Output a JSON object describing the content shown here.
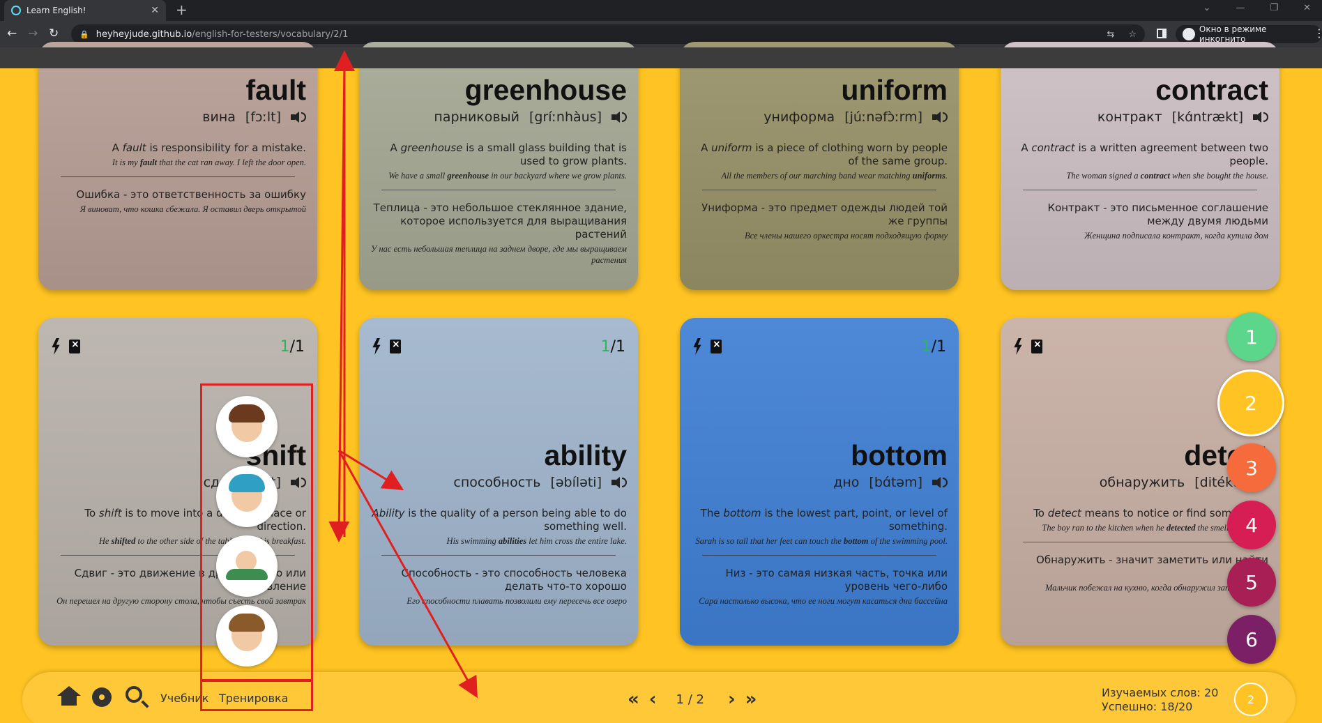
{
  "browser": {
    "tab_title": "Learn English!",
    "new_tab": "+",
    "url_host": "heyheyjude.github.io",
    "url_path": "/english-for-testers/vocabulary/2/1",
    "incognito_label": "Окно в режиме инкогнито"
  },
  "cards_top": [
    {
      "word": "fault",
      "translation": "вина",
      "transcription": "[fɔːlt]",
      "def_pre": "A ",
      "def_word": "fault",
      "def_post": " is responsibility for a mistake.",
      "ex_pre": "It is my ",
      "ex_word": "fault",
      "ex_post": " that the cat ran away. I left the door open.",
      "ru_def": "Ошибка - это ответственность за ошибку",
      "ru_ex": "Я виноват, что кошка сбежала. Я оставил дверь открытой",
      "bg": "#b59d93"
    },
    {
      "word": "greenhouse",
      "translation": "парниковый",
      "transcription": "[gríːnhàus]",
      "def_pre": "A ",
      "def_word": "greenhouse",
      "def_post": " is a small glass building that is used to grow plants.",
      "ex_pre": "We have a small ",
      "ex_word": "greenhouse",
      "ex_post": " in our backyard where we grow plants.",
      "ru_def": "Теплица - это небольшое стеклянное здание, которое используется для выращивания растений",
      "ru_ex": "У нас есть небольшая теплица на заднем дворе, где мы выращиваем растения",
      "bg": "#a4a793"
    },
    {
      "word": "uniform",
      "translation": "униформа",
      "transcription": "[júːnəfɔ̀ːrm]",
      "def_pre": "A ",
      "def_word": "uniform",
      "def_post": " is a piece of clothing worn by people of the same group.",
      "ex_pre": "All the members of our marching band wear matching ",
      "ex_word": "uniforms",
      "ex_post": ".",
      "ru_def": "Униформа - это предмет одежды людей той же группы",
      "ru_ex": "Все члены нашего оркестра носят подходящую форму",
      "bg": "#979167"
    },
    {
      "word": "contract",
      "translation": "контракт",
      "transcription": "[kɑ́ntrækt]",
      "def_pre": "A ",
      "def_word": "contract",
      "def_post": " is a written agreement between two people.",
      "ex_pre": "The woman signed a ",
      "ex_word": "contract",
      "ex_post": " when she bought the house.",
      "ru_def": "Контракт - это письменное соглашение между двумя людьми",
      "ru_ex": "Женщина подписала контракт, когда купила дом",
      "bg": "#cbbec3"
    }
  ],
  "cards_bottom": [
    {
      "word": "shift",
      "translation": "сдвиг",
      "transcription": "[ʃift]",
      "count_done": "1",
      "count_total": "/1",
      "def_pre": "To ",
      "def_word": "shift",
      "def_post": " is to move into a different place or direction.",
      "ex_pre": "He ",
      "ex_word": "shifted",
      "ex_post": " to the other side of the table to eat his breakfast.",
      "ru_def": "Сдвиг - это движение в другое место или направление",
      "ru_ex": "Он перешел на другую сторону стола, чтобы съесть свой завтрак",
      "bg": "#b8b1ab"
    },
    {
      "word": "ability",
      "translation": "способность",
      "transcription": "[əbíləti]",
      "count_done": "1",
      "count_total": "/1",
      "def_pre": "",
      "def_word": "Ability",
      "def_post": " is the quality of a person being able to do something well.",
      "ex_pre": "His swimming ",
      "ex_word": "abilities",
      "ex_post": " let him cross the entire lake.",
      "ru_def": "Способность - это способность человека делать что-то хорошо",
      "ru_ex": "Его способности плавать позволили ему пересечь все озеро",
      "bg": "#9fb4cc"
    },
    {
      "word": "bottom",
      "translation": "дно",
      "transcription": "[bɑ́təm]",
      "count_done": "1",
      "count_total": "/1",
      "def_pre": "The ",
      "def_word": "bottom",
      "def_post": " is the lowest part, point, or level of something.",
      "ex_pre": "Sarah is so tall that her feet can touch the ",
      "ex_word": "bottom",
      "ex_post": " of the swimming pool.",
      "ru_def": "Низ - это самая низкая часть, точка или уровень чего-либо",
      "ru_ex": "Сара настолько высока, что ее ноги могут касаться дна бассейна",
      "bg": "#3f7fd4"
    },
    {
      "word": "detect",
      "translation": "обнаружить",
      "transcription": "[ditékt]",
      "count_done": "1",
      "count_total": "/1",
      "def_pre": "To ",
      "def_word": "detect",
      "def_post": " means to notice or find something.",
      "ex_pre": "The boy ran to the kitchen when he ",
      "ex_word": "detected",
      "ex_post": " the smell of cookies.",
      "ru_def": "Обнаружить - значит заметить или найти что-то",
      "ru_ex": "Мальчик побежал на кухню, когда обнаружил запах печенья",
      "bg": "#c7aea3"
    }
  ],
  "levels": [
    {
      "label": "1",
      "color": "#5cd68a"
    },
    {
      "label": "2",
      "color": "#ffc423"
    },
    {
      "label": "3",
      "color": "#f66b3c"
    },
    {
      "label": "4",
      "color": "#d61e55"
    },
    {
      "label": "5",
      "color": "#a81f55"
    },
    {
      "label": "6",
      "color": "#7b2066"
    }
  ],
  "bottom_bar": {
    "textbook": "Учебник",
    "training": "Тренировка",
    "page": "1 / 2",
    "first": "«",
    "prev": "‹",
    "next": "›",
    "last": "»",
    "learning_words": "Изучаемых слов: 20",
    "success": "Успешно: 18/20",
    "current_level": "2"
  },
  "colors": {
    "background": "#ffc423",
    "annotation_red": "#e02020",
    "progress_green": "#2db55d"
  },
  "avatar_icons": [
    "boy-reading-icon",
    "girl-headphones-icon",
    "boy-flying-icon",
    "boy-aviator-icon"
  ]
}
